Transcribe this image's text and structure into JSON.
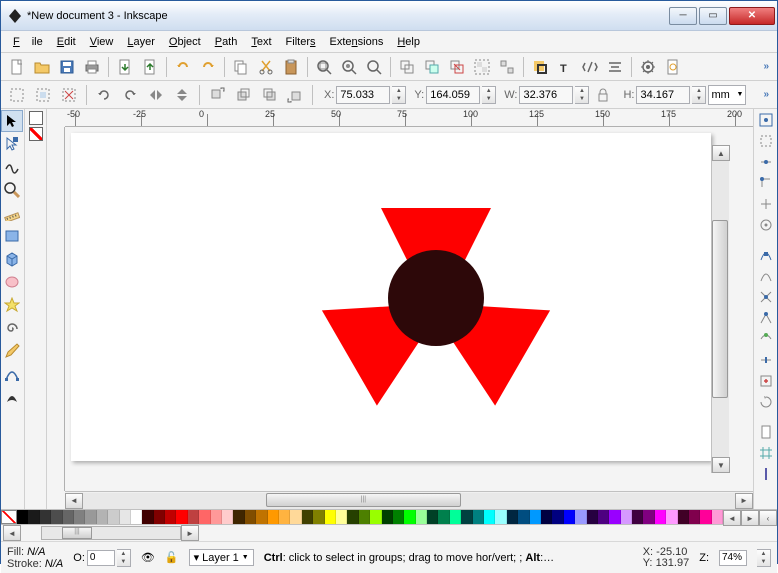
{
  "title": "*New document 3 - Inkscape",
  "menu": {
    "file": "File",
    "edit": "Edit",
    "view": "View",
    "layer": "Layer",
    "object": "Object",
    "path": "Path",
    "text": "Text",
    "filters": "Filters",
    "extensions": "Extensions",
    "help": "Help"
  },
  "coords": {
    "x_label": "X:",
    "x": "75.033",
    "y_label": "Y:",
    "y": "164.059",
    "w_label": "W:",
    "w": "32.376",
    "h_label": "H:",
    "h": "34.167",
    "unit": "mm"
  },
  "ruler": [
    "-50",
    "-25",
    "0",
    "25",
    "50",
    "75",
    "100",
    "125",
    "150",
    "175",
    "200"
  ],
  "status": {
    "fill_label": "Fill:",
    "fill_value": "N/A",
    "stroke_label": "Stroke:",
    "stroke_value": "N/A",
    "opacity_label": "O:",
    "opacity": "0",
    "layer": "Layer 1",
    "hint": "Ctrl: click to select in groups; drag to move hor/vert; ; Alt:…",
    "cursor_x_label": "X:",
    "cursor_x": "-25.10",
    "cursor_y_label": "Y:",
    "cursor_y": "131.97",
    "zoom_label": "Z:",
    "zoom": "74%"
  },
  "palette": [
    "#000000",
    "#1a1a1a",
    "#333333",
    "#4d4d4d",
    "#666666",
    "#808080",
    "#999999",
    "#b3b3b3",
    "#cccccc",
    "#e6e6e6",
    "#ffffff",
    "#400000",
    "#800000",
    "#c00000",
    "#ff0000",
    "#bf4040",
    "#ff6666",
    "#ff9999",
    "#ffcccc",
    "#402600",
    "#804d00",
    "#c07300",
    "#ff9900",
    "#ffb340",
    "#ffd999",
    "#404000",
    "#808000",
    "#ffff00",
    "#ffff99",
    "#264000",
    "#4d8000",
    "#99ff00",
    "#004000",
    "#008000",
    "#00ff00",
    "#99ff99",
    "#004026",
    "#00804d",
    "#00ff99",
    "#004040",
    "#008080",
    "#00ffff",
    "#99ffff",
    "#002640",
    "#004d80",
    "#0099ff",
    "#000040",
    "#000080",
    "#0000ff",
    "#9999ff",
    "#260040",
    "#4d0080",
    "#9900ff",
    "#d699ff",
    "#400040",
    "#800080",
    "#ff00ff",
    "#ff99ff",
    "#400026",
    "#80004d",
    "#ff0099",
    "#ff99d6"
  ]
}
